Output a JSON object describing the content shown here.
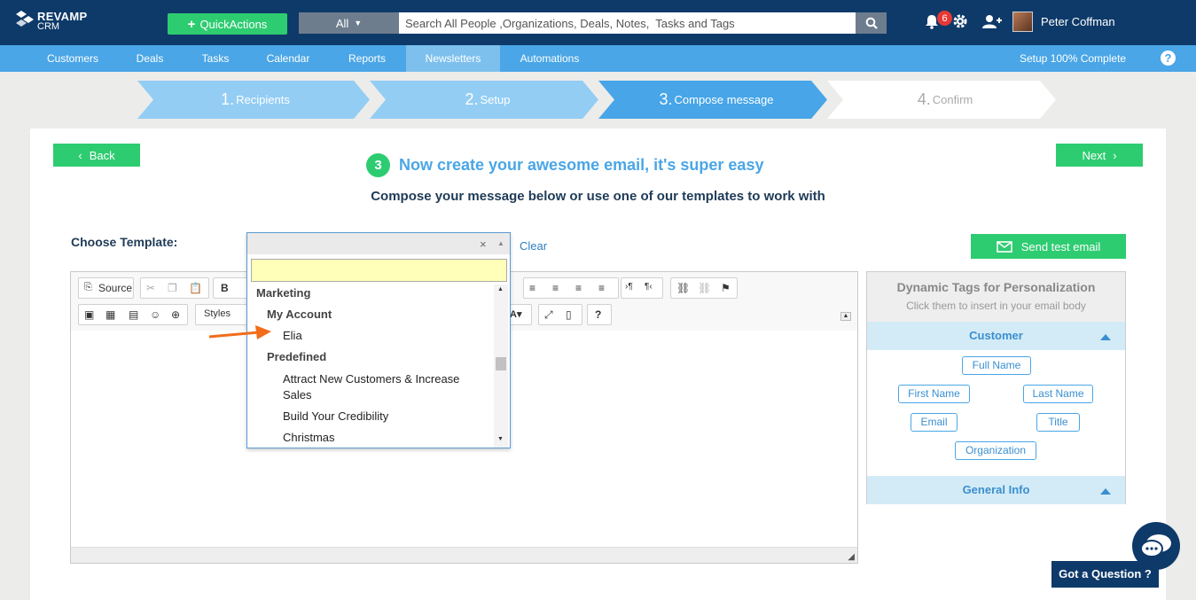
{
  "app": {
    "logo_line1": "REVAMP",
    "logo_line2": "CRM"
  },
  "header": {
    "quick_actions": "QuickActions",
    "search_filter": "All",
    "search_placeholder": "Search All People ,Organizations, Deals, Notes,  Tasks and Tags",
    "notification_count": "6",
    "user_name": "Peter Coffman"
  },
  "nav": {
    "items": [
      "Customers",
      "Deals",
      "Tasks",
      "Calendar",
      "Reports",
      "Newsletters",
      "Automations"
    ],
    "active": "Newsletters",
    "setup_status": "Setup 100% Complete",
    "help": "?"
  },
  "steps": [
    {
      "num": "1.",
      "label": "Recipients"
    },
    {
      "num": "2.",
      "label": "Setup"
    },
    {
      "num": "3.",
      "label": "Compose message"
    },
    {
      "num": "4.",
      "label": "Confirm"
    }
  ],
  "main": {
    "back": "Back",
    "next": "Next",
    "step_number": "3",
    "title": "Now create your awesome email, it's super easy",
    "subtitle": "Compose your message below or use one of our templates to work with",
    "choose_template": "Choose Template:",
    "clear": "Clear",
    "send_test": "Send test email"
  },
  "editor": {
    "source": "Source",
    "bold": "B",
    "styles": "Styles",
    "help": "?"
  },
  "template_dropdown": {
    "clear_x": "×",
    "options": [
      {
        "label": "Marketing",
        "level": 0
      },
      {
        "label": "My Account",
        "level": 1
      },
      {
        "label": "Elia",
        "level": 2
      },
      {
        "label": "Predefined",
        "level": 1
      },
      {
        "label": "Attract New Customers & Increase",
        "level": 2
      },
      {
        "label": "Sales",
        "level": 2
      },
      {
        "label": "Build Your Credibility",
        "level": 2
      },
      {
        "label": "Christmas",
        "level": 2
      }
    ]
  },
  "dynamic_tags": {
    "title": "Dynamic Tags for Personalization",
    "subtitle": "Click them to insert in your email body",
    "customer_section": "Customer",
    "tags": [
      "Full Name",
      "First Name",
      "Last Name",
      "Email",
      "Title",
      "Organization"
    ],
    "general_section": "General Info"
  },
  "chat": {
    "label": "Got a Question ?"
  }
}
